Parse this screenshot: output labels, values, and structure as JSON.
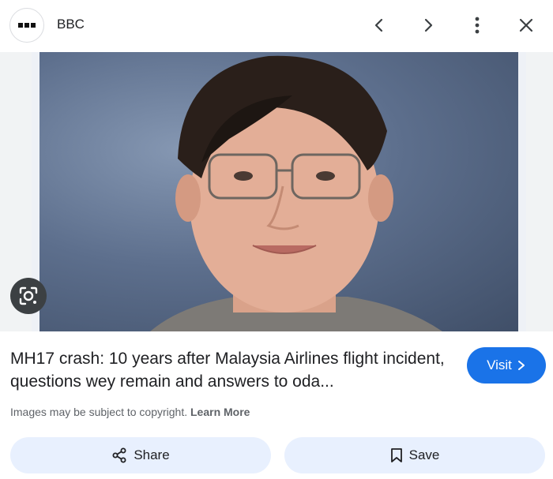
{
  "header": {
    "site_name": "BBC",
    "icons": [
      "site-favicon",
      "chevron-left-icon",
      "chevron-right-icon",
      "more-vert-icon",
      "close-icon"
    ]
  },
  "image": {
    "lens_icon": "google-lens-icon"
  },
  "result": {
    "title": "MH17 crash: 10 years after Malaysia Airlines flight incident, questions wey remain and answers to oda...",
    "visit_label": "Visit",
    "copyright_text": "Images may be subject to copyright.",
    "learn_more": "Learn More"
  },
  "actions": {
    "share_label": "Share",
    "save_label": "Save"
  },
  "colors": {
    "accent": "#1a73e8",
    "pill_bg": "#e8f0fe"
  }
}
